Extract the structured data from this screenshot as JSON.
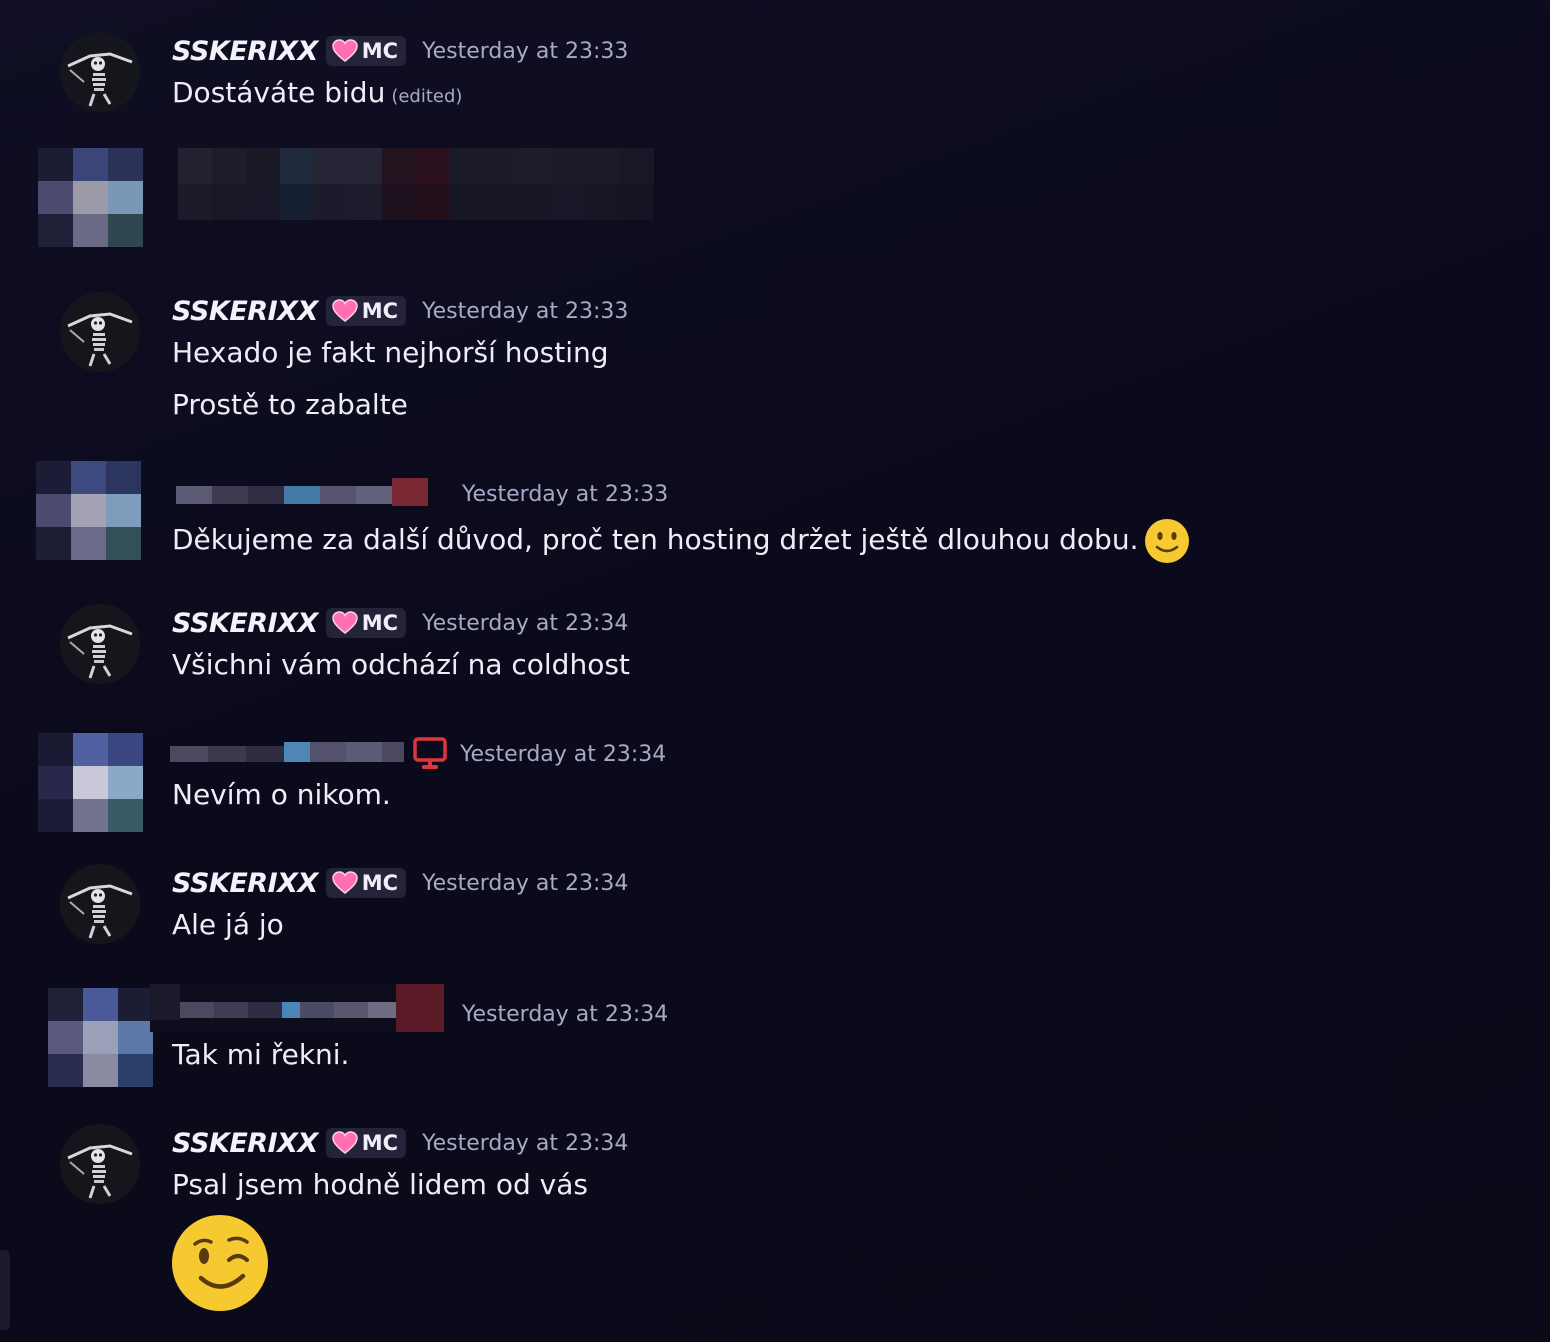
{
  "messages": [
    {
      "author": "SSKERIXX",
      "tag": "MC",
      "timestamp": "Yesterday at 23:33",
      "lines": [
        "Dostáváte bidu"
      ],
      "edited_label": "(edited)"
    },
    {
      "author": "SSKERIXX",
      "tag": "MC",
      "timestamp": "Yesterday at 23:33",
      "lines": [
        "Hexado je fakt nejhorší hosting",
        "Prostě to zabalte"
      ]
    },
    {
      "author_redacted": true,
      "timestamp": "Yesterday at 23:33",
      "lines": [
        "Děkujeme za další důvod, proč ten hosting držet ještě dlouhou dobu."
      ],
      "emoji": "slightly-smiling-face-icon"
    },
    {
      "author": "SSKERIXX",
      "tag": "MC",
      "timestamp": "Yesterday at 23:34",
      "lines": [
        "Všichni vám odchází na coldhost"
      ]
    },
    {
      "author_redacted": true,
      "badge_icon": "desktop-icon",
      "timestamp": "Yesterday at 23:34",
      "lines": [
        "Nevím o nikom."
      ]
    },
    {
      "author": "SSKERIXX",
      "tag": "MC",
      "timestamp": "Yesterday at 23:34",
      "lines": [
        "Ale já jo"
      ]
    },
    {
      "author_redacted": true,
      "timestamp": "Yesterday at 23:34",
      "lines": [
        "Tak mi řekni."
      ]
    },
    {
      "author": "SSKERIXX",
      "tag": "MC",
      "timestamp": "Yesterday at 23:34",
      "lines": [
        "Psal jsem hodně lidem od vás"
      ],
      "emoji": "winking-face-icon"
    }
  ],
  "colors": {
    "background": "#0b0a1c",
    "timestamp": "#a9a8c6",
    "text": "#eeedf6",
    "tag_bg": "#24233a",
    "heart": "#ff6fb1",
    "desktop_icon": "#e0343e",
    "emoji_yellow": "#f7c930"
  }
}
